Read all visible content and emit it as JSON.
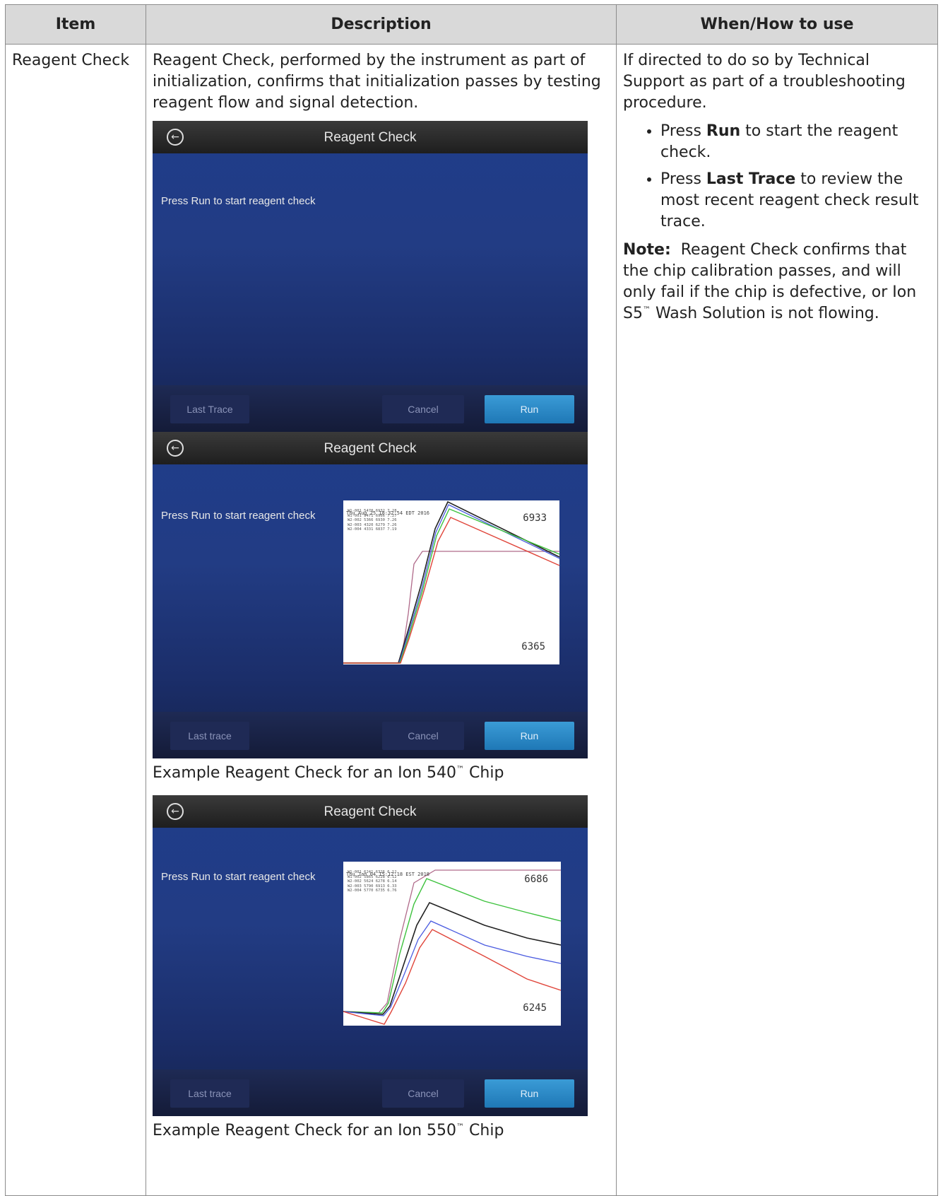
{
  "table": {
    "headers": [
      "Item",
      "Description",
      "When/How to use"
    ],
    "item": "Reagent Check",
    "description": "Reagent Check, performed by the instrument as part of initialization, confirms that initialization passes by testing reagent flow and signal detection.",
    "usage_intro": "If directed to do so by Technical Support as part of a troubleshooting procedure.",
    "bullets": [
      {
        "pre": "Press ",
        "bold": "Run",
        "post": " to start the reagent check."
      },
      {
        "pre": "Press ",
        "bold": "Last Trace",
        "post": " to review the most recent reagent check result trace."
      }
    ],
    "note": {
      "label": "Note:",
      "text_part1": "  Reagent Check confirms that the chip calibration passes, and will only fail if the chip is defective, or Ion S5",
      "tm": "™",
      "text_part2": " Wash Solution is not flowing."
    }
  },
  "screens": [
    {
      "title": "Reagent Check",
      "prompt": "Press Run to start reagent check",
      "buttons": {
        "last_trace": "Last Trace",
        "cancel": "Cancel",
        "run": "Run"
      }
    },
    {
      "title": "Reagent Check",
      "prompt": "Press Run to start reagent check",
      "buttons": {
        "last_trace": "Last trace",
        "cancel": "Cancel",
        "run": "Run"
      },
      "trace": {
        "header": "Thu Aug 25 18:32:54 EDT 2016",
        "legend": [
          "W1-001 5470 6932 7.28",
          "W1-001 5471 6966 7.27",
          "W2-002 5366 6930 7.26",
          "W2-003 4320 6279 7.26",
          "W2-004 4331 6837 7.19"
        ],
        "max_label": "6933",
        "min_label": "6365"
      },
      "caption_pre": "Example Reagent Check for an Ion 540",
      "caption_tm": "™",
      "caption_post": " Chip"
    },
    {
      "title": "Reagent Check",
      "prompt": "Press Run to start reagent check",
      "buttons": {
        "last_trace": "Last trace",
        "cancel": "Cancel",
        "run": "Run"
      },
      "trace": {
        "header": "Thu Jan 04 15:12:18 EST 2018",
        "legend": [
          "W1-001 6241 6326 6.12",
          "W1-002 5865 6228 6.12",
          "W2-002 5624 6278 6.14",
          "W2-003 5790 6913 6.33",
          "W2-004 5770 6735 6.76"
        ],
        "max_label": "6686",
        "min_label": "6245"
      },
      "caption_pre": "Example Reagent Check for an Ion 550",
      "caption_tm": "™",
      "caption_post": " Chip"
    }
  ],
  "colors": {
    "header_bg": "#d9d9d9",
    "border": "#8c8c8c",
    "screen_blue": "#223c84",
    "run_button": "#2a8ac8",
    "trace_black": "#222222",
    "trace_green": "#3ec23e",
    "trace_red": "#e0453a",
    "trace_blue": "#4a5be0",
    "trace_purple": "#b06a8a"
  }
}
